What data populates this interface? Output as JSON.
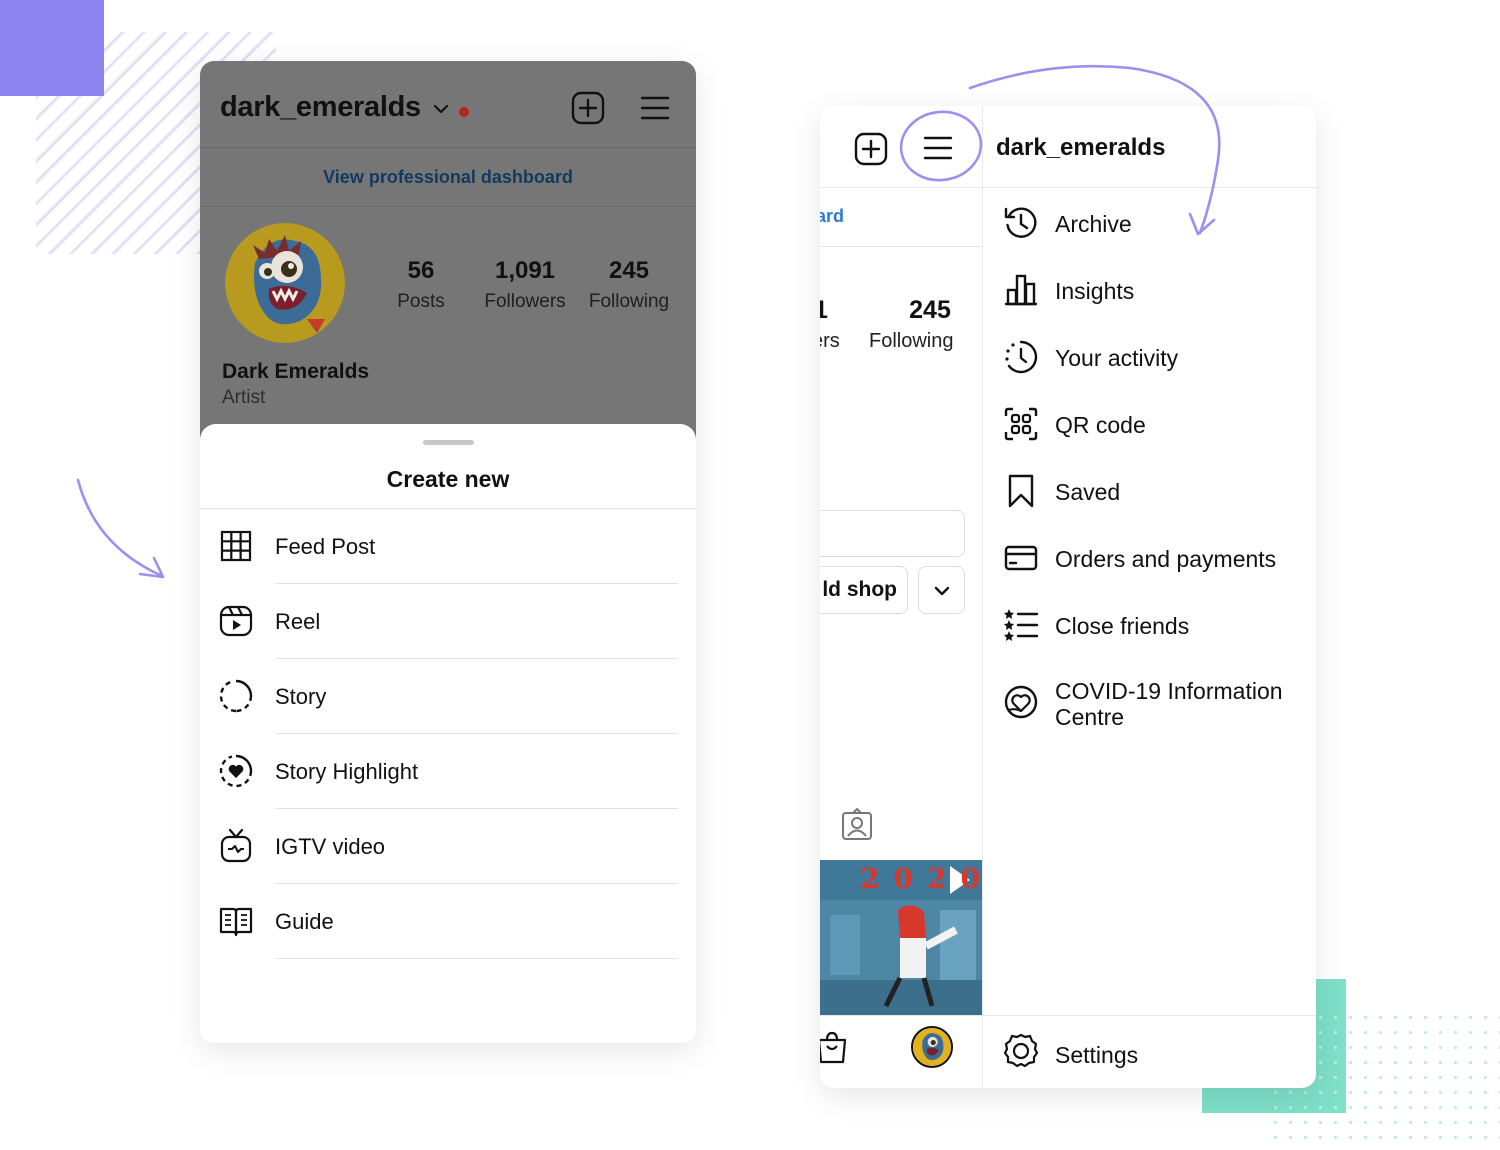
{
  "left_phone": {
    "username": "dark_emeralds",
    "dashboard_link": "View professional dashboard",
    "stats": [
      {
        "value": "56",
        "label": "Posts"
      },
      {
        "value": "1,091",
        "label": "Followers"
      },
      {
        "value": "245",
        "label": "Following"
      }
    ],
    "display_name": "Dark Emeralds",
    "category": "Artist",
    "sheet": {
      "title": "Create new",
      "items": [
        {
          "label": "Feed Post",
          "icon": "grid-icon"
        },
        {
          "label": "Reel",
          "icon": "reel-icon"
        },
        {
          "label": "Story",
          "icon": "story-icon"
        },
        {
          "label": "Story Highlight",
          "icon": "story-highlight-icon"
        },
        {
          "label": "IGTV video",
          "icon": "igtv-icon"
        },
        {
          "label": "Guide",
          "icon": "guide-icon"
        }
      ]
    }
  },
  "right_phone": {
    "username": "dark_emeralds",
    "partial_dashboard": "ard",
    "partial_stat_value": "1",
    "partial_stat_label": "ers",
    "following_value": "245",
    "following_label": "Following",
    "partial_shop_button": "ld shop",
    "video_caption": "2020",
    "menu_items": [
      {
        "label": "Archive",
        "icon": "archive-icon"
      },
      {
        "label": "Insights",
        "icon": "insights-icon"
      },
      {
        "label": "Your activity",
        "icon": "activity-icon"
      },
      {
        "label": "QR code",
        "icon": "qr-code-icon"
      },
      {
        "label": "Saved",
        "icon": "bookmark-icon"
      },
      {
        "label": "Orders and payments",
        "icon": "card-icon"
      },
      {
        "label": "Close friends",
        "icon": "close-friends-icon"
      },
      {
        "label": "COVID-19 Information Centre",
        "icon": "covid-info-icon"
      }
    ],
    "settings_label": "Settings"
  },
  "colors": {
    "accent_purple": "#8f84f0",
    "teal": "#7ee0c9",
    "link_blue": "#2b7bd4",
    "notification_red": "#b3261e"
  }
}
